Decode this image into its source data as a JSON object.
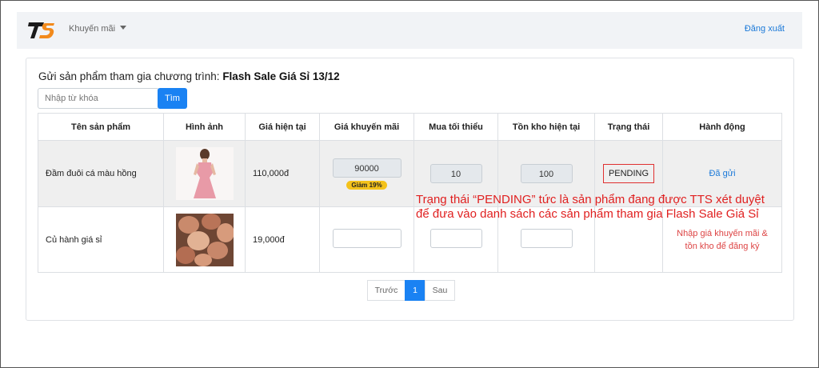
{
  "brand": {
    "logo_text": "TS",
    "colors": {
      "primary": "#1a82f3",
      "accent_orange": "#f28a1c",
      "annotation_red": "#e02020"
    }
  },
  "navbar": {
    "menu_label": "Khuyến mãi",
    "logout_label": "Đăng xuất"
  },
  "page": {
    "heading_prefix": "Gửi sản phẩm tham gia chương trình:",
    "heading_program": "Flash Sale Giá Sỉ 13/12",
    "search": {
      "placeholder": "Nhập từ khóa",
      "button_label": "Tìm"
    }
  },
  "table": {
    "columns": [
      "Tên sản phẩm",
      "Hình ảnh",
      "Giá hiện tại",
      "Giá khuyến mãi",
      "Mua tối thiểu",
      "Tồn kho hiện tại",
      "Trạng thái",
      "Hành động"
    ],
    "rows": [
      {
        "name": "Đầm đuôi cá màu hồng",
        "image_icon": "pink-dress-photo",
        "current_price": "110,000đ",
        "promo_price": "90000",
        "discount_badge": "Giảm 19%",
        "min_purchase": "10",
        "stock": "100",
        "status": "PENDING",
        "action": "Đã gửi"
      },
      {
        "name": "Củ hành giá sỉ",
        "image_icon": "onion-photo",
        "current_price": "19,000đ",
        "promo_price": "",
        "min_purchase": "",
        "stock": "",
        "status": "",
        "action": "Nhập giá khuyến mãi & tồn kho để đăng ký"
      }
    ]
  },
  "pagination": {
    "prev_label": "Trước",
    "current_page": "1",
    "next_label": "Sau"
  },
  "annotation": {
    "line1": "Trạng thái “PENDING” tức là sản phẩm đang được TTS xét duyệt",
    "line2": "để đưa vào danh sách các sản phẩm tham gia Flash Sale Giá Sỉ"
  }
}
